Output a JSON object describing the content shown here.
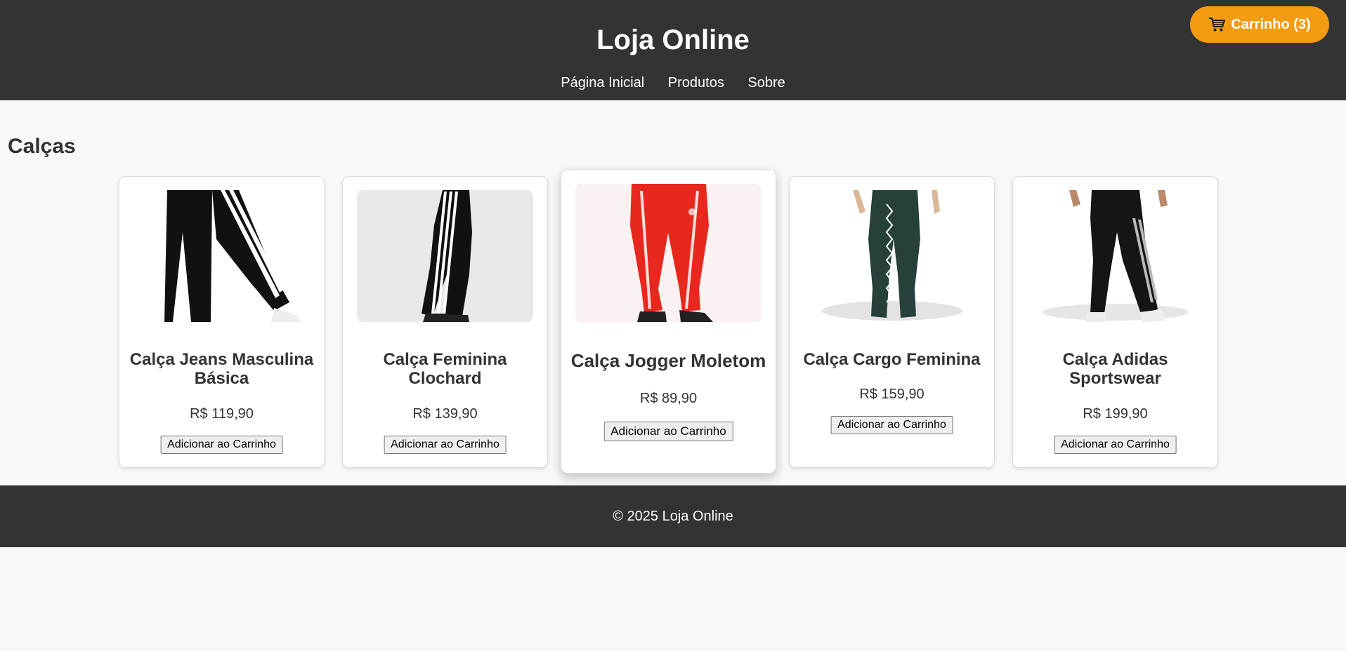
{
  "header": {
    "title": "Loja Online",
    "nav": [
      "Página Inicial",
      "Produtos",
      "Sobre"
    ],
    "cart": {
      "icon": "cart-icon",
      "label": "Carrinho (3)"
    }
  },
  "main": {
    "section_title": "Calças",
    "products": [
      {
        "name": "Calça Jeans Masculina Básica",
        "price": "R$ 119,90",
        "button": "Adicionar ao Carrinho",
        "image_color": "#111111"
      },
      {
        "name": "Calça Feminina Clochard",
        "price": "R$ 139,90",
        "button": "Adicionar ao Carrinho",
        "image_color": "#111111"
      },
      {
        "name": "Calça Jogger Moletom",
        "price": "R$ 89,90",
        "button": "Adicionar ao Carrinho",
        "image_color": "#e8281e"
      },
      {
        "name": "Calça Cargo Feminina",
        "price": "R$ 159,90",
        "button": "Adicionar ao Carrinho",
        "image_color": "#26403c"
      },
      {
        "name": "Calça Adidas Sportswear",
        "price": "R$ 199,90",
        "button": "Adicionar ao Carrinho",
        "image_color": "#151515"
      }
    ]
  },
  "footer": {
    "text": "© 2025 Loja Online"
  },
  "colors": {
    "header_bg": "#333333",
    "accent": "#f39c12",
    "page_bg": "#f8f8f8"
  }
}
